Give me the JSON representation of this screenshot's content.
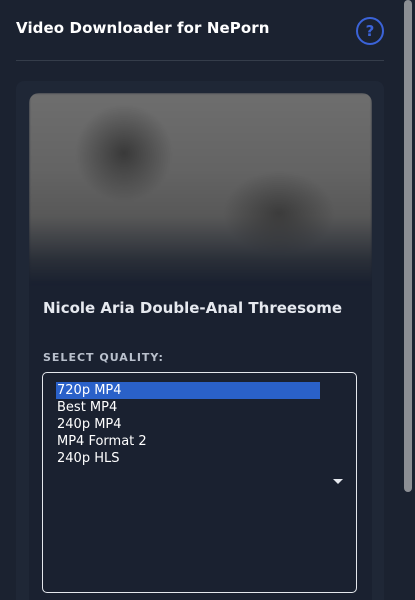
{
  "header": {
    "title": "Video Downloader for NePorn",
    "help_label": "?"
  },
  "video": {
    "title": "Nicole Aria Double-Anal Threesome"
  },
  "quality": {
    "label": "SELECT QUALITY:",
    "options": [
      "720p MP4",
      "Best MP4",
      "240p MP4",
      "MP4 Format 2",
      "240p HLS"
    ],
    "selected": "720p MP4"
  },
  "colors": {
    "background": "#1b2230",
    "accent": "#3b63d8",
    "selection": "#2a61c9"
  }
}
